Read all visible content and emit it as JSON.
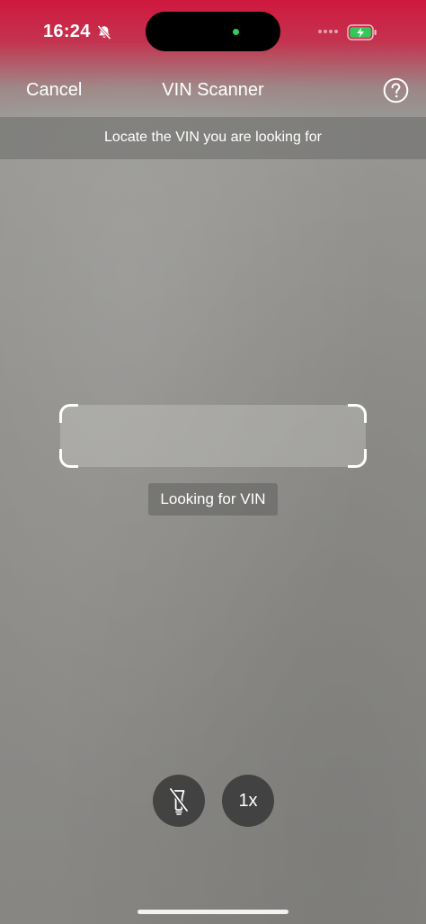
{
  "status_bar": {
    "time": "16:24",
    "silent_icon": "bell-slash-icon",
    "battery_icon": "battery-charging-icon"
  },
  "nav": {
    "cancel_label": "Cancel",
    "title": "VIN Scanner",
    "help_icon": "question-circle-icon"
  },
  "instruction": "Locate the VIN you are looking for",
  "scanner": {
    "status_label": "Looking for VIN"
  },
  "controls": {
    "torch_icon": "flashlight-off-icon",
    "zoom_label": "1x"
  },
  "colors": {
    "top_accent": "#d0183e",
    "battery_fill": "#34c759",
    "island_indicator": "#2fd158"
  }
}
